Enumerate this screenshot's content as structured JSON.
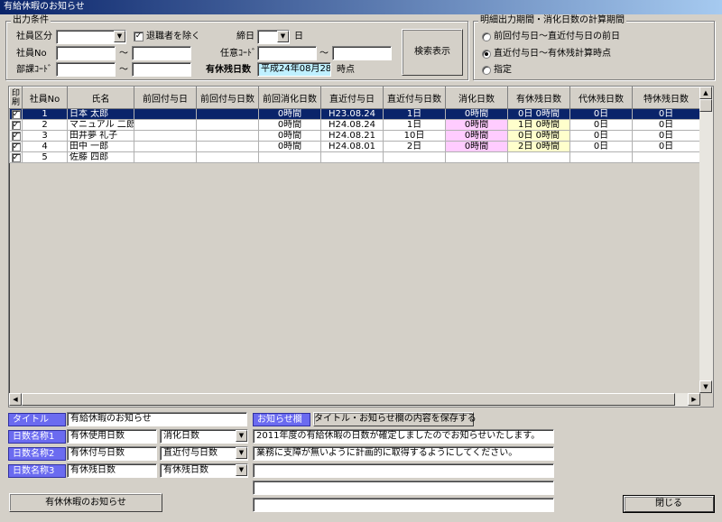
{
  "window": {
    "title": "有給休暇のお知らせ"
  },
  "filter": {
    "group_label": "出力条件",
    "employee_type_label": "社員区分",
    "employee_type_value": "",
    "exclude_retired_label": "退職者を除く",
    "exclude_retired_checked": true,
    "employee_no_label": "社員No",
    "employee_no_from": "",
    "employee_no_to": "",
    "dept_code_label": "部課ｺｰﾄﾞ",
    "dept_code_from": "",
    "dept_code_to": "",
    "tilde": "～",
    "closing_day_label": "締日",
    "closing_day_value": "",
    "day_suffix": "日",
    "optional_code_label": "任意ｺｰﾄﾞ",
    "optional_code_from": "",
    "optional_code_to": "",
    "remaining_days_label": "有休残日数",
    "remaining_date": "平成24年08月28日",
    "time_point_label": "時点",
    "search_button": "検索表示"
  },
  "period": {
    "group_label": "明細出力期間・消化日数の計算期間",
    "options": [
      "前回付与日～直近付与日の前日",
      "直近付与日～有休残計算時点",
      "指定"
    ],
    "selected_index": 1
  },
  "table": {
    "columns": [
      "印刷",
      "社員No",
      "氏名",
      "前回付与日",
      "前回付与日数",
      "前回消化日数",
      "直近付与日",
      "直近付与日数",
      "消化日数",
      "有休残日数",
      "代休残日数",
      "特休残日数"
    ],
    "rows": [
      {
        "print": true,
        "no": "1",
        "name": "日本 太郎",
        "prev_date": "",
        "prev_days": "",
        "prev_used": "0時間",
        "last_date": "H23.08.24",
        "last_days": "1日",
        "used": "0時間",
        "remain": "0日 0時間",
        "comp": "0日",
        "special": "0日"
      },
      {
        "print": true,
        "no": "2",
        "name": "マニュアル 二郎",
        "prev_date": "",
        "prev_days": "",
        "prev_used": "0時間",
        "last_date": "H24.08.24",
        "last_days": "1日",
        "used": "0時間",
        "remain": "1日 0時間",
        "comp": "0日",
        "special": "0日"
      },
      {
        "print": true,
        "no": "3",
        "name": "田井夢 礼子",
        "prev_date": "",
        "prev_days": "",
        "prev_used": "0時間",
        "last_date": "H24.08.21",
        "last_days": "10日",
        "used": "0時間",
        "remain": "0日 0時間",
        "comp": "0日",
        "special": "0日"
      },
      {
        "print": true,
        "no": "4",
        "name": "田中 一郎",
        "prev_date": "",
        "prev_days": "",
        "prev_used": "0時間",
        "last_date": "H24.08.01",
        "last_days": "2日",
        "used": "0時間",
        "remain": "2日 0時間",
        "comp": "0日",
        "special": "0日"
      },
      {
        "print": true,
        "no": "5",
        "name": "佐藤 四郎",
        "prev_date": "",
        "prev_days": "",
        "prev_used": "",
        "last_date": "",
        "last_days": "",
        "used": "",
        "remain": "",
        "comp": "",
        "special": ""
      }
    ]
  },
  "bottom": {
    "title_label": "タイトル",
    "title_value": "有給休暇のお知らせ",
    "notice_label": "お知らせ欄",
    "save_button": "タイトル・お知らせ欄の内容を保存する",
    "day_name1_label": "日数名称1",
    "day_name1_value": "有休使用日数",
    "day_name1_select": "消化日数",
    "day_name2_label": "日数名称2",
    "day_name2_value": "有休付与日数",
    "day_name2_select": "直近付与日数",
    "day_name3_label": "日数名称3",
    "day_name3_value": "有休残日数",
    "day_name3_select": "有休残日数",
    "notice_lines": [
      "2011年度の有給休暇の日数が確定しましたのでお知らせいたします。",
      "業務に支障が無いように計画的に取得するようにしてください。",
      "",
      "",
      ""
    ],
    "notice_button": "有休休暇のお知らせ",
    "close_button": "閉じる"
  }
}
